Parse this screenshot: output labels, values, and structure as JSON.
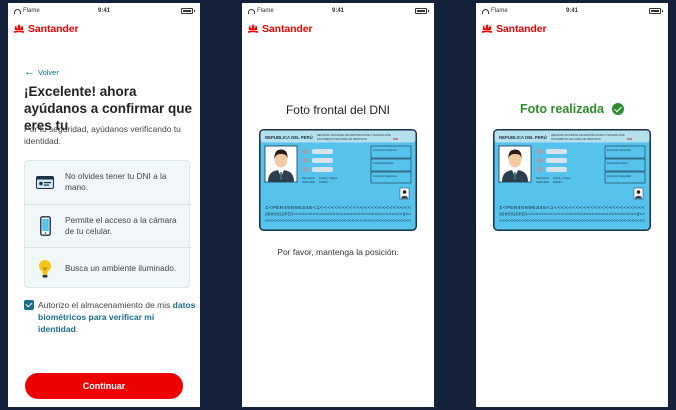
{
  "status_bar": {
    "carrier": "Flame",
    "time": "9:41"
  },
  "brand": {
    "name": "Santander",
    "color": "#ec0000"
  },
  "screen1": {
    "back_label": "Volver",
    "title": "¡Excelente! ahora ayúdanos a confirmar que eres tu",
    "subtitle": "Por tu seguridad, ayúdanos verificando tu identidad.",
    "tips": [
      {
        "icon": "id-card-icon",
        "text": "No olvides tener tu DNI a la mano."
      },
      {
        "icon": "smartphone-icon",
        "text": "Permite el acceso a la cámara de tu celular."
      },
      {
        "icon": "lightbulb-icon",
        "text": "Busca un ambiente iluminado."
      }
    ],
    "consent": {
      "checked": true,
      "text": "Autorizo el almacenamiento de mis ",
      "link_text": "datos biométricos para verificar mi identidad",
      "suffix": "."
    },
    "continue_label": "Continuar"
  },
  "screen2": {
    "title": "Foto frontal del DNI",
    "instruction": "Por favor, mantenga la posición."
  },
  "screen3": {
    "title": "Foto realizada"
  },
  "id_card": {
    "country": "REPUBLICA DEL PERÚ",
    "registry_line1": "REGISTRO NACIONAL DE IDENTIFICACIÓN Y ESTADO CIVIL",
    "registry_line2": "DOCUMENTO NACIONAL DE IDENTIDAD",
    "dni_label": "DNI",
    "field_labels": [
      "Fecha de Inscripción",
      "Fecha de Emisión",
      "Fecha de Caducidad"
    ],
    "small_labels": [
      "Nacimiento",
      "Fecha y Ubigeo"
    ],
    "small_values": [
      "01/01/1990",
      "150101"
    ],
    "mrz_line1": "I<PER45606345<1<<<<<<<<<<<<<<<<<<<<<<<<<",
    "mrz_line2": "800002DPER<<<<<<<<<<<<<<<<<<<<<<<<<<<<<<<<<<<<<<<d<<",
    "mrz_line3": "<<<<<<<<<<<<<<<<<<<<<<<<<<<<<<<<<<<<<<<<<<<<<<<<<<<<<<",
    "colors": {
      "body": "#56c3ec",
      "header": "#b5e0f0",
      "border": "#1b3346"
    }
  }
}
